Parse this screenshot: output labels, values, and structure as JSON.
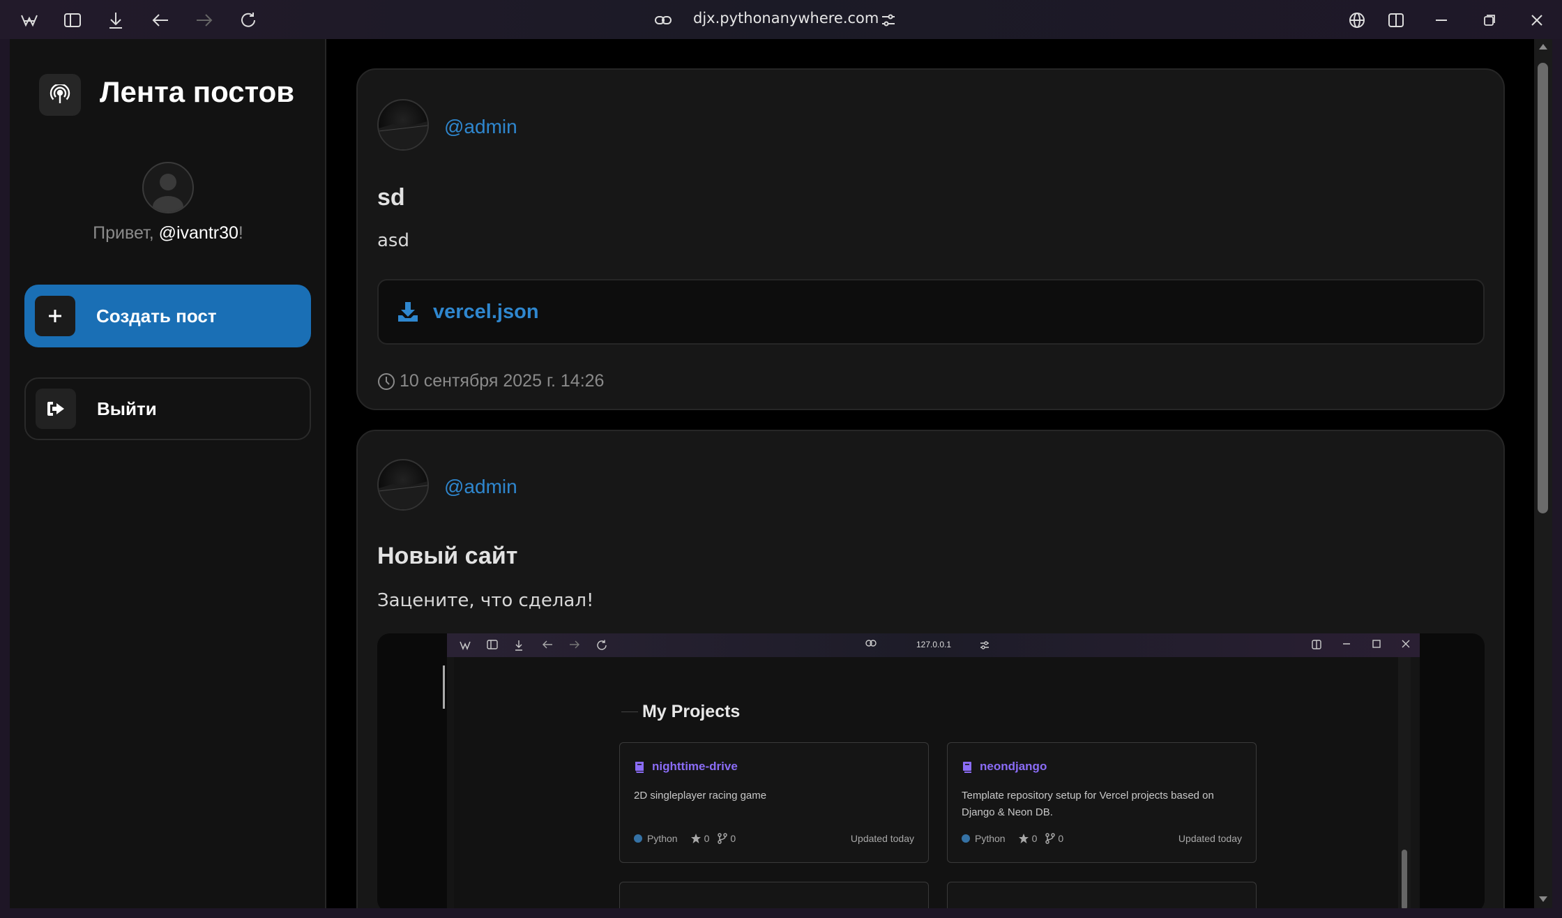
{
  "browser": {
    "url": "djx.pythonanywhere.com"
  },
  "sidebar": {
    "title": "Лента постов",
    "greeting_prefix": "Привет, ",
    "username": "@ivantr30",
    "greeting_suffix": "!",
    "create_label": "Создать пост",
    "logout_label": "Выйти"
  },
  "posts": [
    {
      "author": "@admin",
      "title": "sd",
      "body": "asd",
      "attachment": "vercel.json",
      "date": "10 сентября 2025 г. 14:26"
    },
    {
      "author": "@admin",
      "title": "Новый сайт",
      "body": "Зацените, что сделал!",
      "screenshot": {
        "url": "127.0.0.1",
        "heading": "My Projects",
        "repos": [
          {
            "name": "nighttime-drive",
            "description": "2D singleplayer racing game",
            "language": "Python",
            "stars": "0",
            "forks": "0",
            "updated": "Updated today"
          },
          {
            "name": "neondjango",
            "description": "Template repository setup for Vercel projects based on Django & Neon DB.",
            "language": "Python",
            "stars": "0",
            "forks": "0",
            "updated": "Updated today"
          }
        ]
      }
    }
  ],
  "colors": {
    "accent": "#1a6fb5",
    "link": "#2f87cf",
    "repo_link": "#8a6cf5",
    "python_dot": "#3572A5"
  }
}
